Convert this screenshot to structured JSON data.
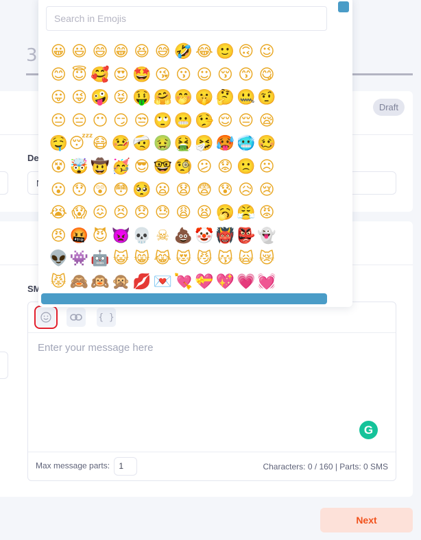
{
  "step": {
    "heading": "3."
  },
  "card1": {
    "status_badge": "Draft",
    "label_partial": "De",
    "input_partial": "N"
  },
  "card2": {
    "label_partial": "SM"
  },
  "editor": {
    "toolbar": {
      "emoji_icon": "smiley-icon",
      "link_icon": "link-icon",
      "variables_label": "{ }"
    },
    "placeholder": "Enter your message here",
    "grammarly_label": "G",
    "footer": {
      "max_parts_label": "Max message parts:",
      "max_parts_value": "1",
      "counter": "Characters: 0 / 160 | Parts: 0 SMS"
    }
  },
  "next_button": "Next",
  "emoji_picker": {
    "search_placeholder": "Search in Emojis",
    "emojis": [
      "😀",
      "😃",
      "😄",
      "😁",
      "😆",
      "😅",
      "🤣",
      "😂",
      "🙂",
      "🙃",
      "😉",
      "😊",
      "😇",
      "🥰",
      "😍",
      "🤩",
      "😘",
      "😗",
      "☺",
      "😚",
      "😙",
      "😋",
      "😛",
      "😜",
      "🤪",
      "😝",
      "🤑",
      "🤗",
      "🤭",
      "🤫",
      "🤔",
      "🤐",
      "🤨",
      "😐",
      "😑",
      "😶",
      "😏",
      "😒",
      "🙄",
      "😬",
      "🤥",
      "😌",
      "😔",
      "😪",
      "🤤",
      "😴",
      "😷",
      "🤒",
      "🤕",
      "🤢",
      "🤮",
      "🤧",
      "🥵",
      "🥶",
      "🥴",
      "😵",
      "🤯",
      "🤠",
      "🥳",
      "😎",
      "🤓",
      "🧐",
      "😕",
      "😟",
      "🙁",
      "☹",
      "😮",
      "😯",
      "😲",
      "😳",
      "🥺",
      "😦",
      "😧",
      "😨",
      "😰",
      "😥",
      "😢",
      "😭",
      "😱",
      "😖",
      "😣",
      "😞",
      "😓",
      "😩",
      "😫",
      "🥱",
      "😤",
      "😡",
      "😠",
      "🤬",
      "😈",
      "👿",
      "💀",
      "☠",
      "💩",
      "🤡",
      "👹",
      "👺",
      "👻",
      "👽",
      "👾",
      "🤖",
      "😺",
      "😸",
      "😹",
      "😻",
      "😼",
      "😽",
      "🙀",
      "😿",
      "😾",
      "🙈",
      "🙉",
      "🙊",
      "💋",
      "💌",
      "💘",
      "💝",
      "💖",
      "💗",
      "💓"
    ]
  },
  "colors": {
    "accent_blue": "#4a9cc7",
    "next_text": "#f1511b",
    "next_bg": "#fde1d9",
    "grammarly": "#15c39a",
    "highlight_red": "#e11d2b"
  }
}
